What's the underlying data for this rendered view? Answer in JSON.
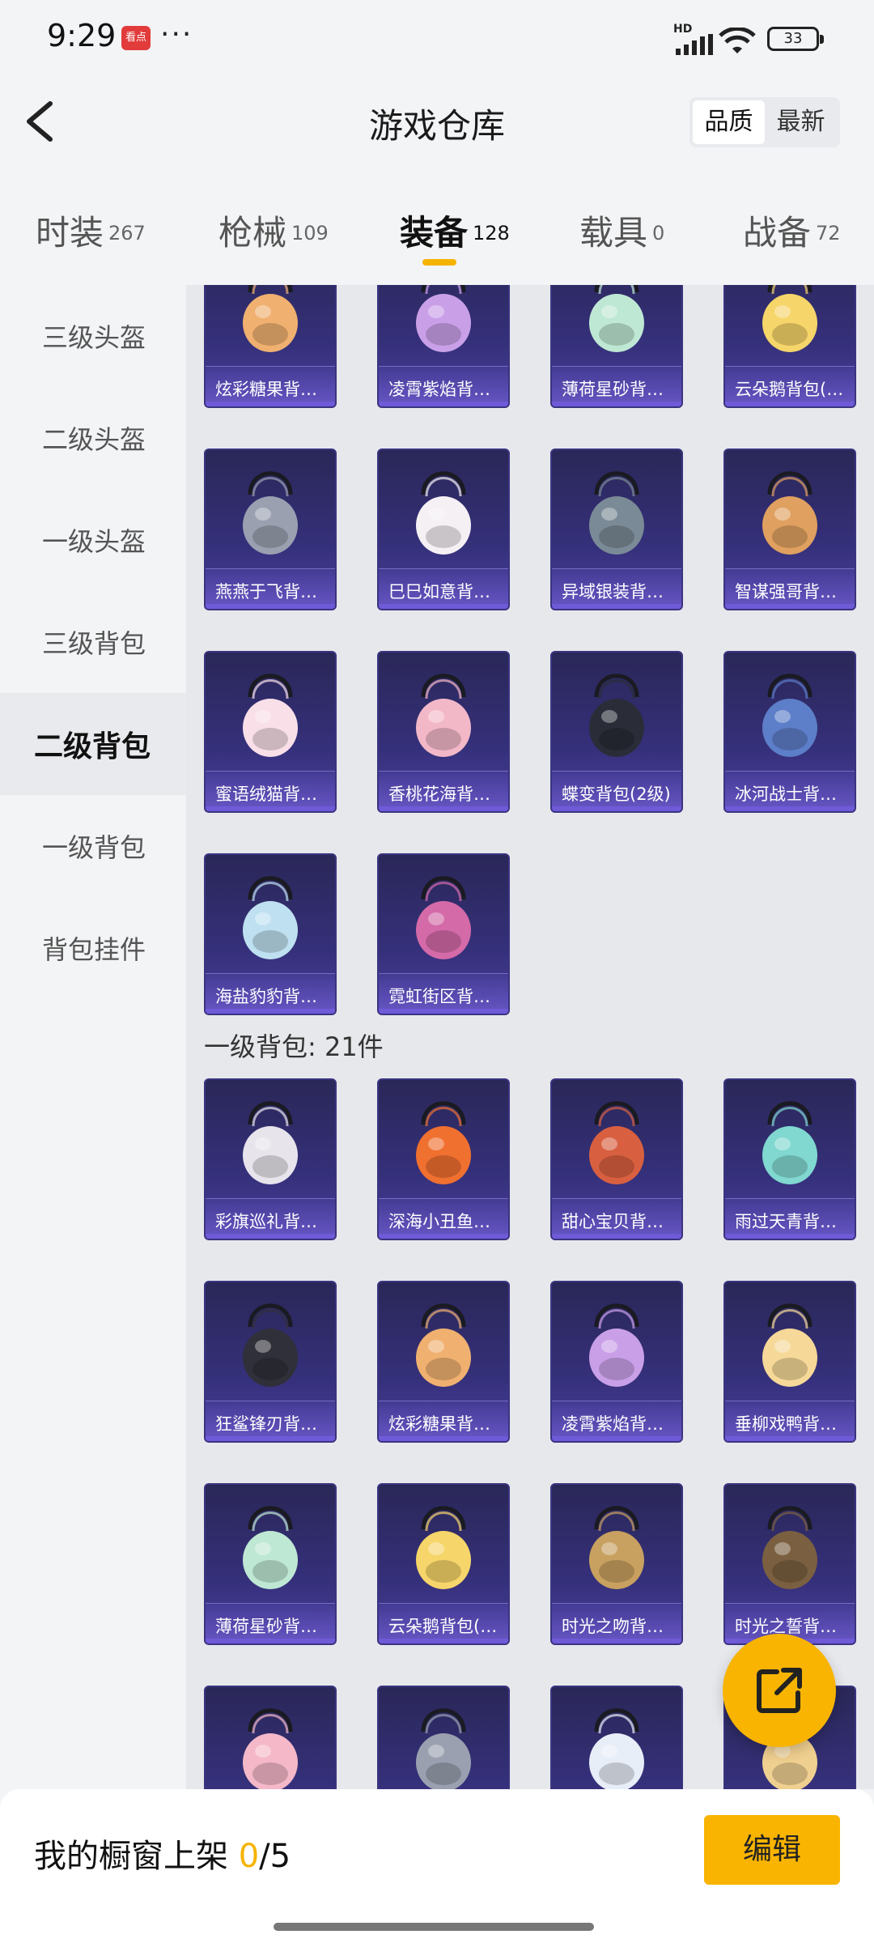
{
  "status": {
    "time": "9:29",
    "app_icon_text": "看点",
    "more": "···",
    "network": "HD",
    "battery": "33"
  },
  "header": {
    "title": "游戏仓库",
    "sort_options": [
      "品质",
      "最新"
    ],
    "active_sort": "品质"
  },
  "categories": [
    {
      "label": "时装",
      "count": "267"
    },
    {
      "label": "枪械",
      "count": "109"
    },
    {
      "label": "装备",
      "count": "128"
    },
    {
      "label": "载具",
      "count": "0"
    },
    {
      "label": "战备",
      "count": "72"
    }
  ],
  "sidebar": {
    "items": [
      "三级头盔",
      "二级头盔",
      "一级头盔",
      "三级背包",
      "二级背包",
      "一级背包",
      "背包挂件"
    ],
    "active": "二级背包"
  },
  "level2_items": [
    {
      "name": "炫彩糖果背…",
      "color": "#f0b070"
    },
    {
      "name": "凌霄紫焰背…",
      "color": "#c9a0e8"
    },
    {
      "name": "薄荷星砂背…",
      "color": "#bfe8d4"
    },
    {
      "name": "云朵鹅背包(…",
      "color": "#f6d56a"
    },
    {
      "name": "燕燕于飞背…",
      "color": "#9aa0b0"
    },
    {
      "name": "巳巳如意背…",
      "color": "#f4f0f4"
    },
    {
      "name": "异域银装背…",
      "color": "#7a8a96"
    },
    {
      "name": "智谋强哥背…",
      "color": "#e0a060"
    },
    {
      "name": "蜜语绒猫背…",
      "color": "#f8dfe8"
    },
    {
      "name": "香桃花海背…",
      "color": "#f3b8c8"
    },
    {
      "name": "蝶变背包(2级)",
      "color": "#2a2d38"
    },
    {
      "name": "冰河战士背…",
      "color": "#5d7ec8"
    },
    {
      "name": "海盐豹豹背…",
      "color": "#bfe0f0"
    },
    {
      "name": "霓虹街区背…",
      "color": "#d46aa8"
    }
  ],
  "level1_section": {
    "label": "一级背包: 21件"
  },
  "level1_items": [
    {
      "name": "彩旗巡礼背…",
      "color": "#e8e4ec"
    },
    {
      "name": "深海小丑鱼…",
      "color": "#f07030"
    },
    {
      "name": "甜心宝贝背…",
      "color": "#d86040"
    },
    {
      "name": "雨过天青背…",
      "color": "#80d8d0"
    },
    {
      "name": "狂鲨锋刃背…",
      "color": "#30303a"
    },
    {
      "name": "炫彩糖果背…",
      "color": "#f0b070"
    },
    {
      "name": "凌霄紫焰背…",
      "color": "#c9a0e8"
    },
    {
      "name": "垂柳戏鸭背…",
      "color": "#f6d898"
    },
    {
      "name": "薄荷星砂背…",
      "color": "#bfe8d4"
    },
    {
      "name": "云朵鹅背包(…",
      "color": "#f6d56a"
    },
    {
      "name": "时光之吻背…",
      "color": "#c8a060"
    },
    {
      "name": "时光之誓背…",
      "color": "#7a6040"
    },
    {
      "name": "",
      "color": "#f4b8c8"
    },
    {
      "name": "",
      "color": "#9aa0b0"
    },
    {
      "name": "",
      "color": "#e8eef8"
    },
    {
      "name": "",
      "color": "#f0d090"
    }
  ],
  "bottom_bar": {
    "label": "我的橱窗上架",
    "used": "0",
    "total": "/5",
    "edit_label": "编辑"
  }
}
